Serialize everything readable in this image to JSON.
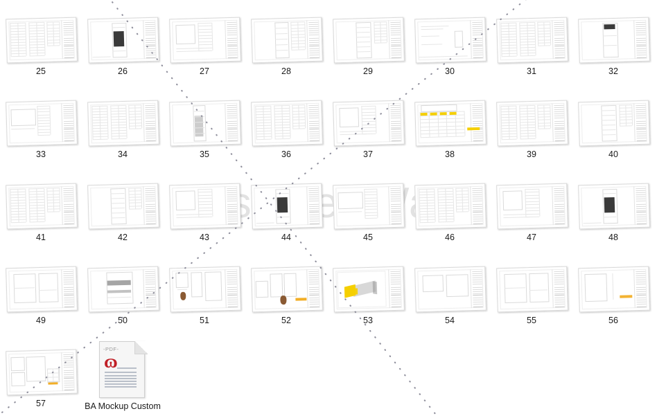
{
  "window": {
    "background_color": "#ffffff",
    "watermark_text": "Designer Wang",
    "watermark_color": "#e2e2e2"
  },
  "selection": {
    "marquee_style": "dotted-diagonal",
    "dot_color": "#8a8a99"
  },
  "file_browser": {
    "view_mode": "large-icons",
    "columns": 8,
    "items": [
      {
        "label": "25",
        "kind": "drawing-sheet",
        "pattern": "schedule-table"
      },
      {
        "label": "26",
        "kind": "drawing-sheet",
        "pattern": "elevation-dark-unit"
      },
      {
        "label": "27",
        "kind": "drawing-sheet",
        "pattern": "plan-detail"
      },
      {
        "label": "28",
        "kind": "drawing-sheet",
        "pattern": "elevation-tall"
      },
      {
        "label": "29",
        "kind": "drawing-sheet",
        "pattern": "elevation-shelf"
      },
      {
        "label": "30",
        "kind": "drawing-sheet",
        "pattern": "note-sheet"
      },
      {
        "label": "31",
        "kind": "drawing-sheet",
        "pattern": "schedule-table"
      },
      {
        "label": "32",
        "kind": "drawing-sheet",
        "pattern": "elevation-dark-top"
      },
      {
        "label": "33",
        "kind": "drawing-sheet",
        "pattern": "section-detail"
      },
      {
        "label": "34",
        "kind": "drawing-sheet",
        "pattern": "schedule-table"
      },
      {
        "label": "35",
        "kind": "drawing-sheet",
        "pattern": "elevation-tall-grey"
      },
      {
        "label": "36",
        "kind": "drawing-sheet",
        "pattern": "schedule-table"
      },
      {
        "label": "37",
        "kind": "drawing-sheet",
        "pattern": "plan-detail"
      },
      {
        "label": "38",
        "kind": "drawing-sheet",
        "pattern": "table-yellow-highlight"
      },
      {
        "label": "39",
        "kind": "drawing-sheet",
        "pattern": "schedule-table"
      },
      {
        "label": "40",
        "kind": "drawing-sheet",
        "pattern": "elevation-shelf"
      },
      {
        "label": "41",
        "kind": "drawing-sheet",
        "pattern": "schedule-table"
      },
      {
        "label": "42",
        "kind": "drawing-sheet",
        "pattern": "elevation-shelf"
      },
      {
        "label": "43",
        "kind": "drawing-sheet",
        "pattern": "plan-detail"
      },
      {
        "label": "44",
        "kind": "drawing-sheet",
        "pattern": "elevation-dark-unit"
      },
      {
        "label": "45",
        "kind": "drawing-sheet",
        "pattern": "section-detail"
      },
      {
        "label": "46",
        "kind": "drawing-sheet",
        "pattern": "schedule-table"
      },
      {
        "label": "47",
        "kind": "drawing-sheet",
        "pattern": "plan-detail"
      },
      {
        "label": "48",
        "kind": "drawing-sheet",
        "pattern": "elevation-dark-unit"
      },
      {
        "label": "49",
        "kind": "drawing-sheet",
        "pattern": "elevation-frame"
      },
      {
        "label": "50",
        "kind": "drawing-sheet",
        "pattern": "elevation-grey-bands"
      },
      {
        "label": "51",
        "kind": "drawing-sheet",
        "pattern": "detail-stand"
      },
      {
        "label": "52",
        "kind": "drawing-sheet",
        "pattern": "detail-multi-orange"
      },
      {
        "label": "53",
        "kind": "drawing-sheet",
        "pattern": "render-yellow-box"
      },
      {
        "label": "54",
        "kind": "drawing-sheet",
        "pattern": "plan-outline"
      },
      {
        "label": "55",
        "kind": "drawing-sheet",
        "pattern": "elevation-frame"
      },
      {
        "label": "56",
        "kind": "drawing-sheet",
        "pattern": "detail-orange"
      },
      {
        "label": "57",
        "kind": "drawing-sheet",
        "pattern": "plan-orange"
      },
      {
        "label": "BA Mockup Custom",
        "kind": "pdf-document",
        "pattern": "pdf",
        "icon": "pdf-file-icon",
        "icon_tag": "PDF",
        "icon_accent": "#c02027"
      }
    ]
  }
}
